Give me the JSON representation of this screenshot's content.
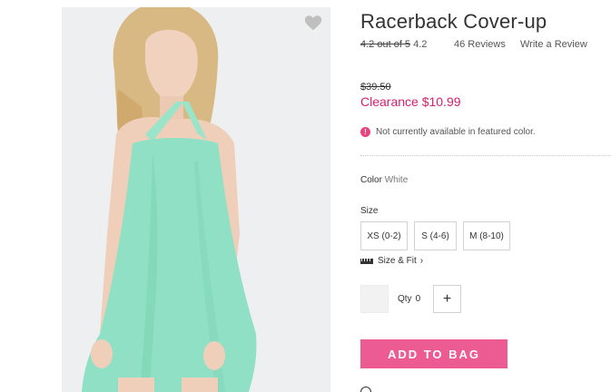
{
  "product": {
    "title": "Racerback Cover-up",
    "rating_struck": "4.2 out of 5",
    "rating_value": "4.2",
    "reviews": "46 Reviews",
    "write_review": "Write a Review",
    "favorite_icon": "heart-icon"
  },
  "price": {
    "original": "$39.50",
    "clearance": "Clearance $10.99",
    "clearance_color": "#d6206f"
  },
  "availability": {
    "message": "Not currently available in featured color.",
    "icon": "alert-icon",
    "icon_text": "!"
  },
  "color": {
    "label": "Color",
    "value": "White"
  },
  "size": {
    "label": "Size",
    "options": [
      "XS (0-2)",
      "S (4-6)",
      "M (8-10)"
    ],
    "size_fit": "Size & Fit",
    "chevron": "›"
  },
  "quantity": {
    "label": "Qty",
    "value": "0",
    "plus": "+"
  },
  "cta": {
    "add_to_bag": "ADD TO BAG",
    "color": "#ec5b91"
  },
  "image": {
    "garment_color": "#8fe0c4",
    "subject": "model wearing mint racerback cover-up"
  }
}
